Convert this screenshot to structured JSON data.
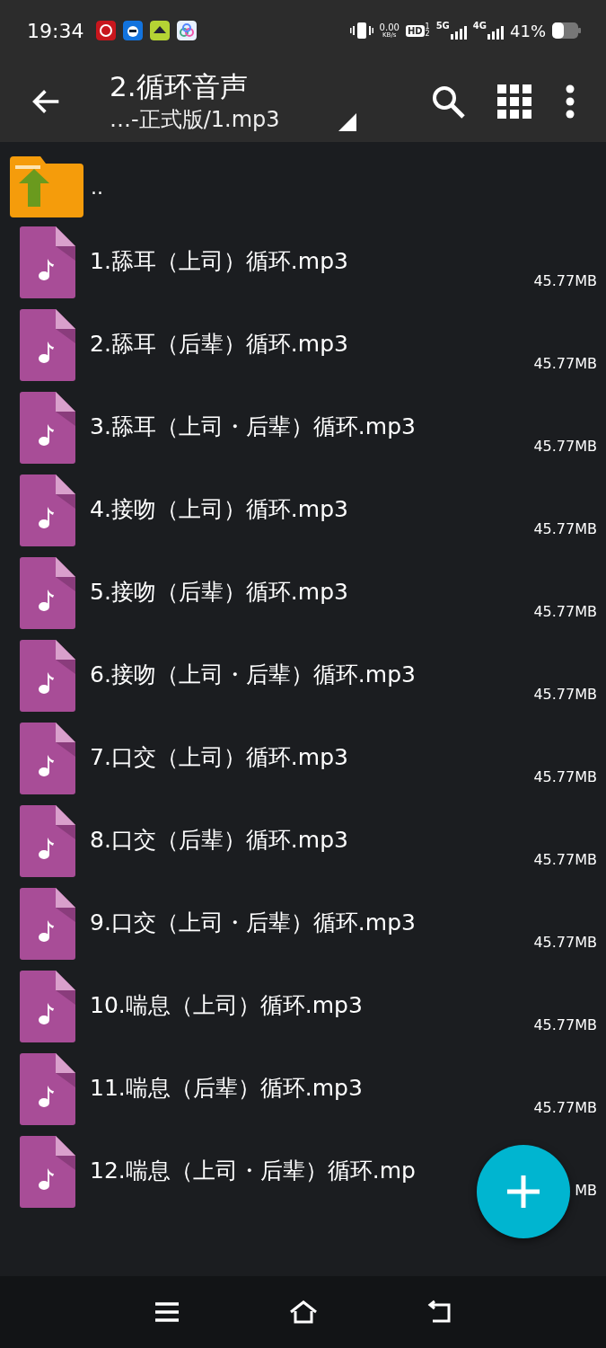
{
  "status_bar": {
    "time": "19:34",
    "net_speed": {
      "value": "0.00",
      "unit": "KB/s"
    },
    "hd_badge": "HD",
    "hd_slots": [
      "1",
      "2"
    ],
    "networks": [
      {
        "label": "5G"
      },
      {
        "label": "4G"
      }
    ],
    "battery": "41%"
  },
  "toolbar": {
    "title": "2.循环音声",
    "subtitle": "…-正式版/1.mp3"
  },
  "parent_entry": {
    "name": ".."
  },
  "files": [
    {
      "name": "1.舔耳（上司）循环.mp3",
      "size": "45.77MB"
    },
    {
      "name": "2.舔耳（后辈）循环.mp3",
      "size": "45.77MB"
    },
    {
      "name": "3.舔耳（上司・后辈）循环.mp3",
      "size": "45.77MB"
    },
    {
      "name": "4.接吻（上司）循环.mp3",
      "size": "45.77MB"
    },
    {
      "name": "5.接吻（后辈）循环.mp3",
      "size": "45.77MB"
    },
    {
      "name": "6.接吻（上司・后辈）循环.mp3",
      "size": "45.77MB"
    },
    {
      "name": "7.口交（上司）循环.mp3",
      "size": "45.77MB"
    },
    {
      "name": "8.口交（后辈）循环.mp3",
      "size": "45.77MB"
    },
    {
      "name": "9.口交（上司・后辈）循环.mp3",
      "size": "45.77MB"
    },
    {
      "name": "10.喘息（上司）循环.mp3",
      "size": "45.77MB"
    },
    {
      "name": "11.喘息（后辈）循环.mp3",
      "size": "45.77MB"
    },
    {
      "name": "12.喘息（上司・后辈）循环.mp",
      "size": "MB"
    }
  ]
}
